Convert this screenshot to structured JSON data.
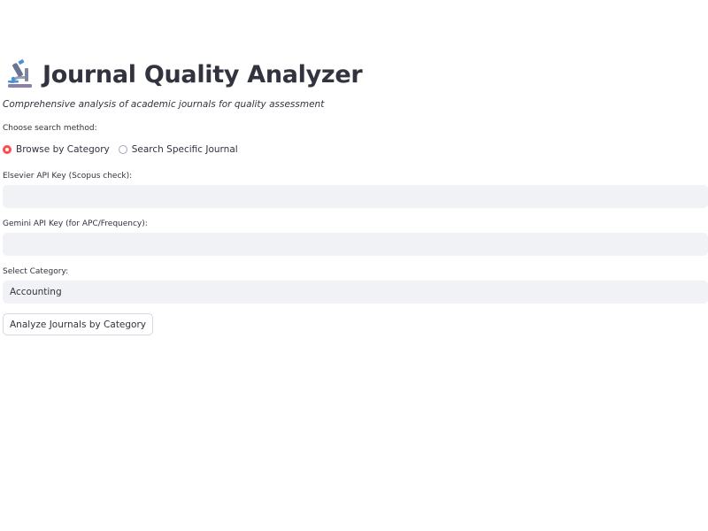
{
  "header": {
    "icon": "microscope-icon",
    "title": "Journal Quality Analyzer",
    "subtitle": "Comprehensive analysis of academic journals for quality assessment"
  },
  "search_method": {
    "label": "Choose search method:",
    "options": [
      "Browse by Category",
      "Search Specific Journal"
    ],
    "selected": "Browse by Category"
  },
  "elsevier_key": {
    "label": "Elsevier API Key (Scopus check):",
    "value": ""
  },
  "gemini_key": {
    "label": "Gemini API Key (for APC/Frequency):",
    "value": ""
  },
  "category": {
    "label": "Select Category:",
    "value": "Accounting"
  },
  "analyze_button": {
    "label": "Analyze Journals by Category"
  },
  "colors": {
    "accent": "#ff4b4b",
    "input_bg": "#f0f2f6",
    "text": "#31333f"
  }
}
